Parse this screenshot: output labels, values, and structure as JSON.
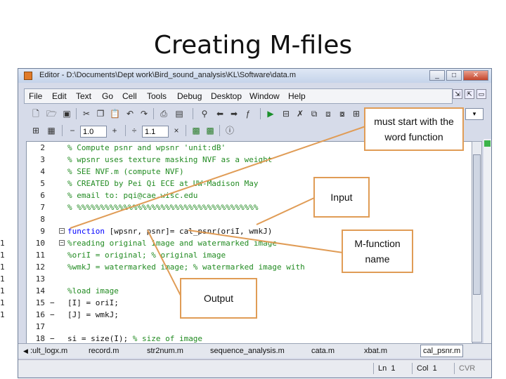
{
  "slide": {
    "title": "Creating M-files"
  },
  "window": {
    "title": "Editor - D:\\Documents\\Dept work\\Bird_sound_analysis\\KL\\Software\\data.m",
    "buttons": [
      "_",
      "□",
      "✕"
    ]
  },
  "menubar": {
    "items": [
      "File",
      "Edit",
      "Text",
      "Go",
      "Cell",
      "Tools",
      "Debug",
      "Desktop",
      "Window",
      "Help"
    ]
  },
  "toolbar": {
    "cell_minus": "−",
    "field1_value": "1.0",
    "plus": "+",
    "divide": "÷",
    "field2_value": "1.1",
    "times": "×"
  },
  "editor": {
    "lines": [
      {
        "num": "2",
        "mark": "",
        "text": "% Compute psnr and wpsnr        'unit:dB'",
        "kind": "comment"
      },
      {
        "num": "3",
        "mark": "",
        "text": "% wpsnr uses texture masking NVF as a weight",
        "kind": "comment"
      },
      {
        "num": "4",
        "mark": "",
        "text": "% SEE NVF.m (compute NVF)",
        "kind": "comment"
      },
      {
        "num": "5",
        "mark": "",
        "text": "% CREATED by Pei Qi  ECE at UW-Madison  May",
        "kind": "comment"
      },
      {
        "num": "6",
        "mark": "",
        "text": "% email to: pqi@cae.wisc.edu",
        "kind": "comment"
      },
      {
        "num": "7",
        "mark": "",
        "text": "% %%%%%%%%%%%%%%%%%%%%%%%%%%%%%%%%%%%%%%%",
        "kind": "comment"
      },
      {
        "num": "8",
        "mark": "",
        "text": "",
        "kind": "plain"
      },
      {
        "num": "9",
        "mark": "",
        "text_kw": "function",
        "text": " [wpsnr, psnr]= cal_psnr(oriI, wmkJ)",
        "kind": "function",
        "fold": "−"
      },
      {
        "num": "10",
        "mark": "",
        "text": "%reading original image and watermarked image",
        "kind": "comment",
        "fold": "−"
      },
      {
        "num": "11",
        "mark": "",
        "text": "%oriI = original;     % original image",
        "kind": "comment"
      },
      {
        "num": "12",
        "mark": "",
        "text": "%wmkJ = watermarked image;  % watermarked image with",
        "kind": "comment"
      },
      {
        "num": "13",
        "mark": "",
        "text": "",
        "kind": "plain"
      },
      {
        "num": "14",
        "mark": "",
        "text": "%load image",
        "kind": "comment"
      },
      {
        "num": "15",
        "mark": "−",
        "text": "[I] = oriI;",
        "kind": "plain"
      },
      {
        "num": "16",
        "mark": "−",
        "text": "[J] = wmkJ;",
        "kind": "plain"
      },
      {
        "num": "17",
        "mark": "",
        "text": "",
        "kind": "plain"
      },
      {
        "num": "18",
        "mark": "−",
        "text_code": "si = size(I);    ",
        "text": "% size of image",
        "kind": "mixed"
      }
    ],
    "outside_numbers": [
      "1",
      "1",
      "1",
      "1",
      "1",
      "1",
      "1"
    ]
  },
  "tabs": {
    "items": [
      ":ult_logx.m",
      "record.m",
      "str2num.m",
      "sequence_analysis.m",
      "cata.m",
      "xbat.m",
      "cal_psnr.m"
    ],
    "active_index": 6
  },
  "status": {
    "ln_label": "Ln",
    "ln_value": "1",
    "col_label": "Col",
    "col_value": "1",
    "mode": "CVR"
  },
  "callouts": {
    "must_start": "must start with the word function",
    "input": "Input",
    "mfunction_name": "M-function name",
    "output": "Output"
  },
  "colors": {
    "accent": "#e09c56",
    "comment": "#228b22",
    "keyword": "#0000ff"
  }
}
